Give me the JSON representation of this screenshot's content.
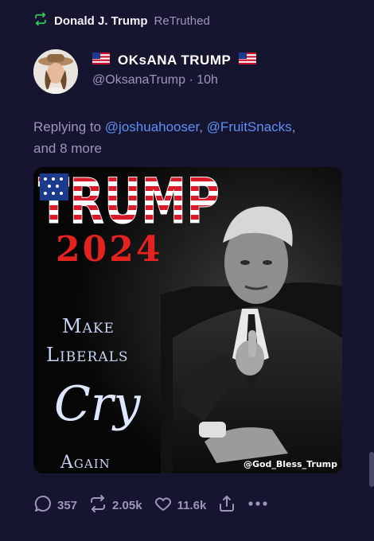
{
  "retruth": {
    "author": "Donald J. Trump",
    "verb": "ReTruthed",
    "icon": "retruth-icon"
  },
  "post": {
    "display_name": "OKsANA TRUMP",
    "handle": "@OksanaTrump",
    "separator": "·",
    "time": "10h",
    "replying_prefix": "Replying to",
    "mention_1": "@joshuahooser",
    "mention_2": "@FruitSnacks",
    "reply_suffix_comma": ",",
    "reply_suffix": "and 8 more"
  },
  "media": {
    "line_trump": "TRUMP",
    "line_year": "2024",
    "line_make": "Make",
    "line_liberals": "Liberals",
    "line_cry": "Cry",
    "line_again": "Again",
    "watermark": "@God_Bless_Trump"
  },
  "actions": {
    "replies": "357",
    "retruths": "2.05k",
    "likes": "11.6k"
  },
  "colors": {
    "background": "#161530",
    "accent_link": "#5f8ff5",
    "retruth_green": "#34c759",
    "muted": "#9a98b4"
  }
}
